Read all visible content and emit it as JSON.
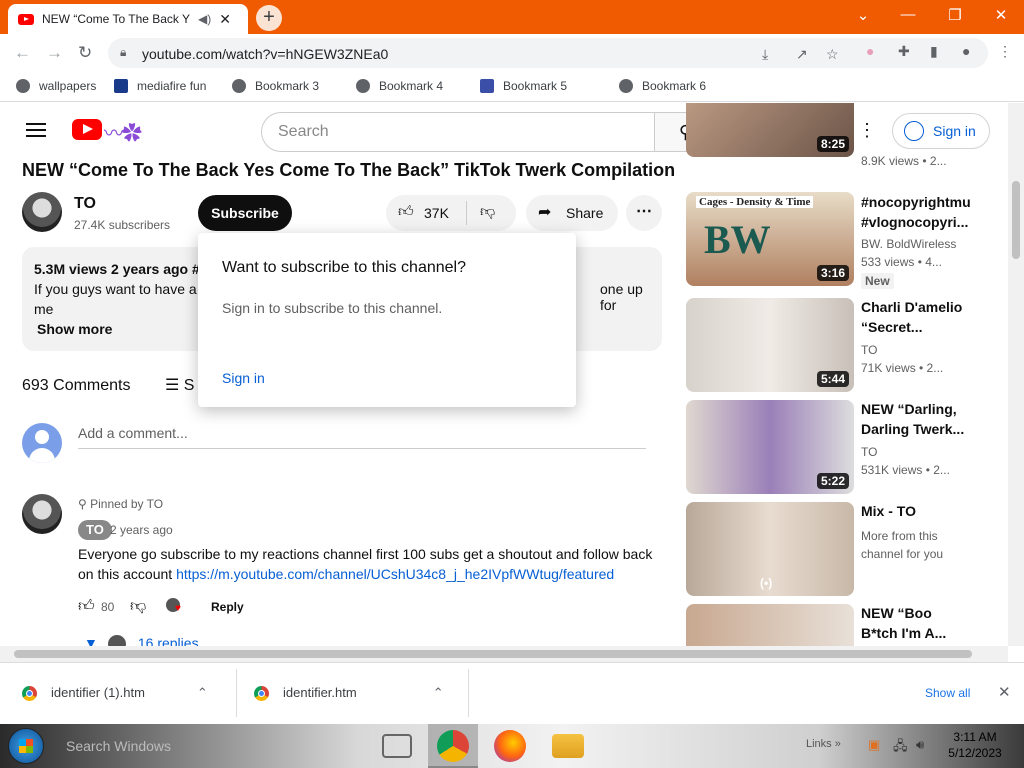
{
  "browser": {
    "tab_title": "NEW “Come To The Back Y",
    "tab_close": "✕",
    "new_tab": "+",
    "url": "youtube.com/watch?v=hNGEW3ZNEa0",
    "window_controls": [
      "⌄",
      "—",
      "❐",
      "✕"
    ]
  },
  "bookmarks": [
    {
      "label": "wallpapers"
    },
    {
      "label": "mediafire fun"
    },
    {
      "label": "Bookmark 3"
    },
    {
      "label": "Bookmark 4"
    },
    {
      "label": "Bookmark 5"
    },
    {
      "label": "Bookmark 6"
    }
  ],
  "header": {
    "search_placeholder": "Search",
    "signin_label": "Sign in"
  },
  "video": {
    "title": "NEW “Come To The Back Yes Come To The Back” TikTok Twerk Compilation",
    "channel_name": "TO",
    "subscribers": "27.4K subscribers",
    "subscribe_label": "Subscribe",
    "likes": "37K",
    "share_label": "Share",
    "more_label": "⋯",
    "desc_meta": "5.3M views  2 years ago  #",
    "desc_line1": "If you guys want to have a",
    "desc_line1_end": "one up for",
    "desc_line2": "me",
    "show_more": "Show more"
  },
  "comments": {
    "count_label": "693 Comments",
    "sort_label": "S",
    "add_placeholder": "Add a comment...",
    "pinned_label": "Pinned by TO",
    "author": "TO",
    "time": "2 years ago",
    "text_line1": "Everyone go subscribe to my reactions channel first 100 subs get a shoutout and follow back",
    "text_line2_prefix": "on this account ",
    "link": "https://m.youtube.com/channel/UCshU34c8_j_he2IVpfWWtug/featured",
    "like_count": "80",
    "reply_label": "Reply",
    "replies_label": "16 replies"
  },
  "popup": {
    "title": "Want to subscribe to this channel?",
    "body": "Sign in to subscribe to this channel.",
    "signin": "Sign in"
  },
  "sidebar": [
    {
      "title": "",
      "line1": "8.9K views  •  2...",
      "duration": "8:25"
    },
    {
      "title": "#nocopyrightmu #vlognocopyri...",
      "line1": "BW. BoldWireless",
      "line2": "533 views  •  4...",
      "badge": "New",
      "duration": "3:16",
      "thumb_text": "Cages - Density & Time"
    },
    {
      "title": "Charli D'amelio “Secret...",
      "line1": "TO",
      "line2": "71K views  •  2...",
      "duration": "5:44"
    },
    {
      "title": "NEW “Darling, Darling Twerk...",
      "line1": "TO",
      "line2": "531K views  •  2...",
      "duration": "5:22"
    },
    {
      "title": "Mix - TO",
      "line1": "More from this channel for you",
      "duration": "(•)"
    },
    {
      "title": "NEW “Boo B*tch I'm A...",
      "line1": "",
      "duration": ""
    }
  ],
  "downloads": {
    "file1": "identifier (1).htm",
    "file2": "identifier.htm",
    "show_all": "Show all"
  },
  "taskbar": {
    "search_placeholder": "Search Windows",
    "links_label": "Links",
    "time": "3:11 AM",
    "date": "5/12/2023"
  }
}
